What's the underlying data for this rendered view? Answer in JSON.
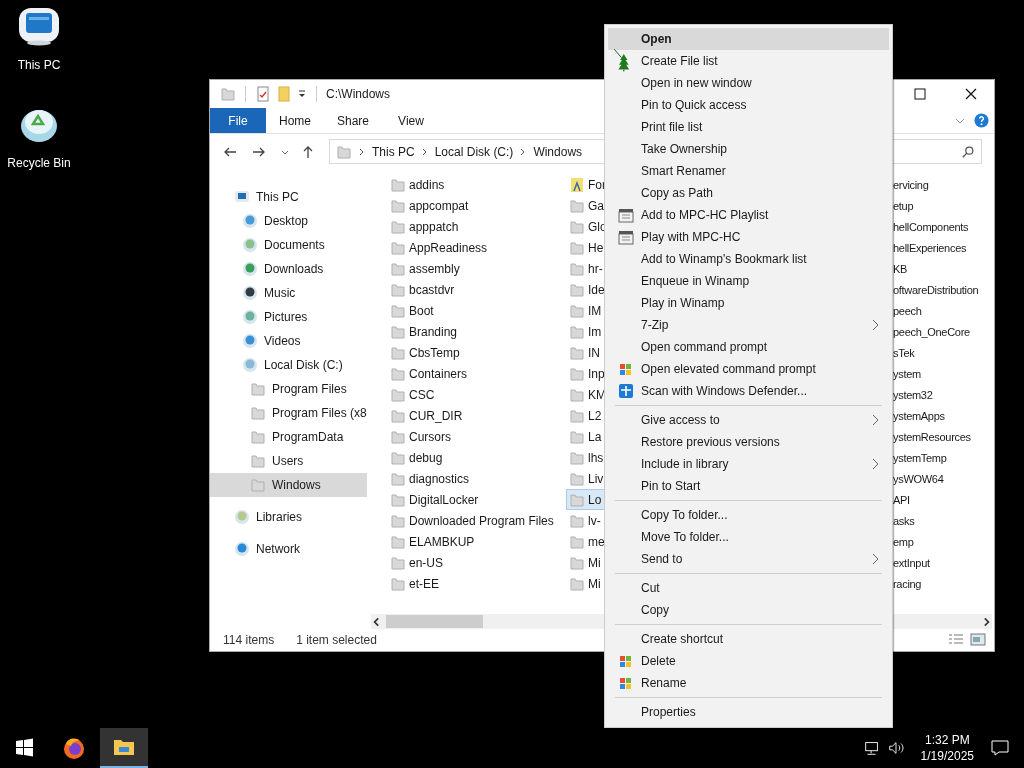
{
  "desktop_icons": [
    {
      "label": "This PC",
      "kind": "computer"
    },
    {
      "label": "Recycle Bin",
      "kind": "recycle"
    }
  ],
  "window": {
    "title": "C:\\Windows",
    "file_tab": "File",
    "ribbon_tabs": [
      {
        "label": "Home",
        "selected": false
      },
      {
        "label": "Share",
        "selected": false
      },
      {
        "label": "View",
        "selected": false
      }
    ],
    "address": [
      "This PC",
      "Local Disk (C:)",
      "Windows"
    ],
    "nav": [
      {
        "label": "This PC",
        "kind": "pc",
        "selected": false,
        "children": [
          {
            "label": "Desktop",
            "kind": "desktop",
            "selected": false
          },
          {
            "label": "Documents",
            "kind": "documents",
            "selected": false
          },
          {
            "label": "Downloads",
            "kind": "downloads",
            "selected": false
          },
          {
            "label": "Music",
            "kind": "music",
            "selected": false
          },
          {
            "label": "Pictures",
            "kind": "pictures",
            "selected": false
          },
          {
            "label": "Videos",
            "kind": "videos",
            "selected": false
          },
          {
            "label": "Local Disk (C:)",
            "kind": "disk",
            "selected": false,
            "children": [
              {
                "label": "Program Files",
                "kind": "folder",
                "selected": false
              },
              {
                "label": "Program Files (x8",
                "kind": "folder",
                "selected": false
              },
              {
                "label": "ProgramData",
                "kind": "folder",
                "selected": false
              },
              {
                "label": "Users",
                "kind": "folder",
                "selected": false
              },
              {
                "label": "Windows",
                "kind": "folder",
                "selected": true
              }
            ]
          }
        ]
      },
      {
        "label": "Libraries",
        "kind": "libraries",
        "selected": false
      },
      {
        "label": "Network",
        "kind": "network",
        "selected": false
      }
    ],
    "column_1": [
      {
        "name": "addins",
        "selected": false
      },
      {
        "name": "appcompat",
        "selected": false
      },
      {
        "name": "apppatch",
        "selected": false
      },
      {
        "name": "AppReadiness",
        "selected": false
      },
      {
        "name": "assembly",
        "selected": false
      },
      {
        "name": "bcastdvr",
        "selected": false
      },
      {
        "name": "Boot",
        "selected": false
      },
      {
        "name": "Branding",
        "selected": false
      },
      {
        "name": "CbsTemp",
        "selected": false
      },
      {
        "name": "Containers",
        "selected": false
      },
      {
        "name": "CSC",
        "selected": false
      },
      {
        "name": "CUR_DIR",
        "selected": false
      },
      {
        "name": "Cursors",
        "selected": false
      },
      {
        "name": "debug",
        "selected": false
      },
      {
        "name": "diagnostics",
        "selected": false
      },
      {
        "name": "DigitalLocker",
        "selected": false
      },
      {
        "name": "Downloaded Program Files",
        "selected": false
      },
      {
        "name": "ELAMBKUP",
        "selected": false
      },
      {
        "name": "en-US",
        "selected": false
      },
      {
        "name": "et-EE",
        "selected": false
      }
    ],
    "column_2": [
      {
        "name": "For",
        "kind": "fonts",
        "selected": false
      },
      {
        "name": "Ga",
        "kind": "folder",
        "selected": false
      },
      {
        "name": "Glo",
        "kind": "folder",
        "selected": false
      },
      {
        "name": "He",
        "kind": "folder",
        "selected": false
      },
      {
        "name": "hr-",
        "kind": "folder",
        "selected": false
      },
      {
        "name": "Ide",
        "kind": "folder",
        "selected": false
      },
      {
        "name": "IM",
        "kind": "folder",
        "selected": false
      },
      {
        "name": "Im",
        "kind": "folder",
        "selected": false
      },
      {
        "name": "IN",
        "kind": "folder",
        "selected": false
      },
      {
        "name": "Inp",
        "kind": "folder",
        "selected": false
      },
      {
        "name": "KM",
        "kind": "folder",
        "selected": false
      },
      {
        "name": "L2",
        "kind": "folder",
        "selected": false
      },
      {
        "name": "La",
        "kind": "folder",
        "selected": false
      },
      {
        "name": "lhs",
        "kind": "folder",
        "selected": false
      },
      {
        "name": "Liv",
        "kind": "folder",
        "selected": false
      },
      {
        "name": "Lo",
        "kind": "folder",
        "selected": true
      },
      {
        "name": "lv-",
        "kind": "folder",
        "selected": false
      },
      {
        "name": "me",
        "kind": "folder",
        "selected": false
      },
      {
        "name": "Mi",
        "kind": "folder",
        "selected": false
      },
      {
        "name": "Mi",
        "kind": "folder",
        "selected": false
      }
    ],
    "column_3": [
      {
        "name": "ervicing",
        "selected": false
      },
      {
        "name": "etup",
        "selected": false
      },
      {
        "name": "hellComponents",
        "selected": false
      },
      {
        "name": "hellExperiences",
        "selected": false
      },
      {
        "name": "KB",
        "selected": false
      },
      {
        "name": "oftwareDistribution",
        "selected": false
      },
      {
        "name": "peech",
        "selected": false
      },
      {
        "name": "peech_OneCore",
        "selected": false
      },
      {
        "name": "sTek",
        "selected": false
      },
      {
        "name": "ystem",
        "selected": false
      },
      {
        "name": "ystem32",
        "selected": false
      },
      {
        "name": "ystemApps",
        "selected": false
      },
      {
        "name": "ystemResources",
        "selected": false
      },
      {
        "name": "ystemTemp",
        "selected": false
      },
      {
        "name": "ysWOW64",
        "selected": false
      },
      {
        "name": "API",
        "selected": false
      },
      {
        "name": "asks",
        "selected": false
      },
      {
        "name": "emp",
        "selected": false
      },
      {
        "name": "extInput",
        "selected": false
      },
      {
        "name": "racing",
        "selected": false
      }
    ],
    "status": {
      "items": "114 items",
      "selection": "1 item selected"
    }
  },
  "context_menu": [
    {
      "kind": "item",
      "label": "Open",
      "selected": true,
      "submenu": false
    },
    {
      "kind": "item",
      "label": "Create File list",
      "selected": false,
      "submenu": false
    },
    {
      "kind": "item",
      "label": "Open in new window",
      "selected": false,
      "submenu": false
    },
    {
      "kind": "item",
      "label": "Pin to Quick access",
      "selected": false,
      "submenu": false
    },
    {
      "kind": "item",
      "label": "Print file list",
      "selected": false,
      "submenu": false
    },
    {
      "kind": "item",
      "label": "Take Ownership",
      "selected": false,
      "submenu": false
    },
    {
      "kind": "item",
      "label": "Smart Renamer",
      "selected": false,
      "submenu": false
    },
    {
      "kind": "item",
      "label": "Copy as Path",
      "selected": false,
      "submenu": false
    },
    {
      "kind": "mpc",
      "label": "Add to MPC-HC Playlist",
      "selected": false,
      "submenu": false
    },
    {
      "kind": "mpc",
      "label": "Play with MPC-HC",
      "selected": false,
      "submenu": false
    },
    {
      "kind": "item",
      "label": "Add to Winamp's Bookmark list",
      "selected": false,
      "submenu": false
    },
    {
      "kind": "item",
      "label": "Enqueue in Winamp",
      "selected": false,
      "submenu": false
    },
    {
      "kind": "item",
      "label": "Play in Winamp",
      "selected": false,
      "submenu": false
    },
    {
      "kind": "item",
      "label": "7-Zip",
      "selected": false,
      "submenu": true
    },
    {
      "kind": "item",
      "label": "Open command prompt",
      "selected": false,
      "submenu": false
    },
    {
      "kind": "flag",
      "label": "Open elevated command prompt",
      "selected": false,
      "submenu": false
    },
    {
      "kind": "shield",
      "label": "Scan with Windows Defender...",
      "selected": false,
      "submenu": false
    },
    {
      "kind": "separator"
    },
    {
      "kind": "item",
      "label": "Give access to",
      "selected": false,
      "submenu": true
    },
    {
      "kind": "item",
      "label": "Restore previous versions",
      "selected": false,
      "submenu": false
    },
    {
      "kind": "item",
      "label": "Include in library",
      "selected": false,
      "submenu": true
    },
    {
      "kind": "item",
      "label": "Pin to Start",
      "selected": false,
      "submenu": false
    },
    {
      "kind": "separator"
    },
    {
      "kind": "item",
      "label": "Copy To folder...",
      "selected": false,
      "submenu": false
    },
    {
      "kind": "item",
      "label": "Move To folder...",
      "selected": false,
      "submenu": false
    },
    {
      "kind": "item",
      "label": "Send to",
      "selected": false,
      "submenu": true
    },
    {
      "kind": "separator"
    },
    {
      "kind": "item",
      "label": "Cut",
      "selected": false,
      "submenu": false
    },
    {
      "kind": "item",
      "label": "Copy",
      "selected": false,
      "submenu": false
    },
    {
      "kind": "separator"
    },
    {
      "kind": "item",
      "label": "Create shortcut",
      "selected": false,
      "submenu": false
    },
    {
      "kind": "flag",
      "label": "Delete",
      "selected": false,
      "submenu": false
    },
    {
      "kind": "flag",
      "label": "Rename",
      "selected": false,
      "submenu": false
    },
    {
      "kind": "separator"
    },
    {
      "kind": "item",
      "label": "Properties",
      "selected": false,
      "submenu": false
    }
  ],
  "taskbar": {
    "apps": [
      {
        "kind": "firefox",
        "active": false
      },
      {
        "kind": "explorer",
        "active": true
      }
    ],
    "time": "1:32 PM",
    "date": "1/19/2025"
  }
}
